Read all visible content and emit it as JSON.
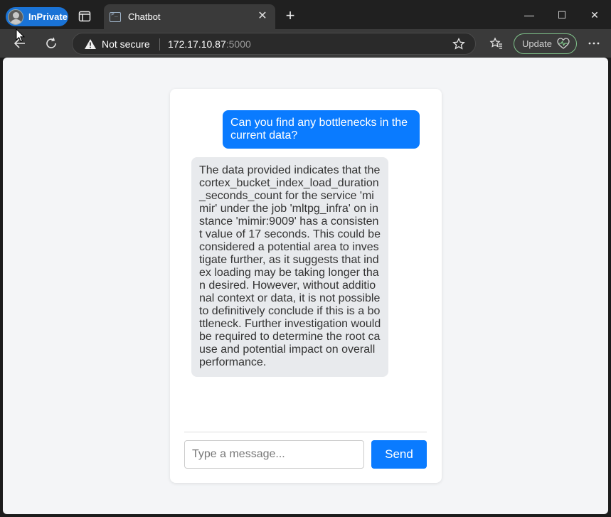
{
  "browser": {
    "profile_label": "InPrivate",
    "tab_title": "Chatbot",
    "tab_close": "✕",
    "new_tab": "+",
    "security_label": "Not secure",
    "url_host": "172.17.10.87",
    "url_port": ":5000",
    "update_label": "Update",
    "icons": {
      "profile": "avatar-icon",
      "tabs": "tab-actions-icon",
      "back": "back-arrow-icon",
      "refresh": "refresh-icon",
      "warning": "warning-icon",
      "favorite": "star-icon",
      "favorites": "favorites-icon",
      "update": "heartbeat-icon",
      "more": "more-icon"
    }
  },
  "window": {
    "minimize": "—",
    "maximize": "☐",
    "close": "✕"
  },
  "chat": {
    "messages": [
      {
        "role": "user",
        "text": "Can you find any bottlenecks in the current data?"
      },
      {
        "role": "bot",
        "text": "The data provided indicates that the cortex_bucket_index_load_duration_seconds_count for the service 'mimir' under the job 'mltpg_infra' on instance 'mimir:9009' has a consistent value of 17 seconds. This could be considered a potential area to investigate further, as it suggests that index loading may be taking longer than desired. However, without additional context or data, it is not possible to definitively conclude if this is a bottleneck. Further investigation would be required to determine the root cause and potential impact on overall performance."
      }
    ],
    "input_placeholder": "Type a message...",
    "input_value": "",
    "send_label": "Send"
  },
  "colors": {
    "accent": "#0a7bff",
    "bot_bubble": "#e8eaed",
    "inprivate": "#1a73d6"
  }
}
